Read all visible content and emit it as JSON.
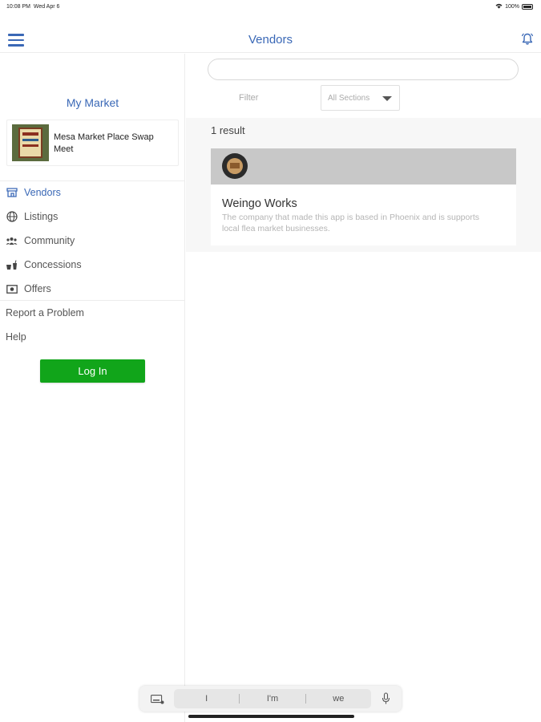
{
  "status_bar": {
    "time": "10:08 PM",
    "date": "Wed Apr 6",
    "battery": "100%"
  },
  "header": {
    "title": "Vendors",
    "menu_icon": "hamburger-menu-icon",
    "bell_icon": "bell-icon"
  },
  "accent_color": "#3a68b6",
  "sidebar": {
    "market_heading": "My Market",
    "market_name": "Mesa Market Place Swap Meet",
    "nav_items": [
      {
        "label": "Vendors",
        "icon": "storefront-icon",
        "active": true
      },
      {
        "label": "Listings",
        "icon": "globe-icon",
        "active": false
      },
      {
        "label": "Community",
        "icon": "people-icon",
        "active": false
      },
      {
        "label": "Concessions",
        "icon": "food-drink-icon",
        "active": false
      },
      {
        "label": "Offers",
        "icon": "offer-tag-icon",
        "active": false
      }
    ],
    "report_problem": "Report a Problem",
    "help": "Help",
    "login_label": "Log In",
    "login_color": "#11a51a"
  },
  "main": {
    "search_value": "",
    "filter_label": "Filter",
    "section_select_value": "All Sections",
    "result_count": "1 result",
    "vendors": [
      {
        "name": "Weingo Works",
        "description": "The company that made this app is based in Phoenix and is supports local flea market businesses."
      }
    ]
  },
  "keyboard_bar": {
    "suggestions": [
      "I",
      "I'm",
      "we"
    ]
  }
}
